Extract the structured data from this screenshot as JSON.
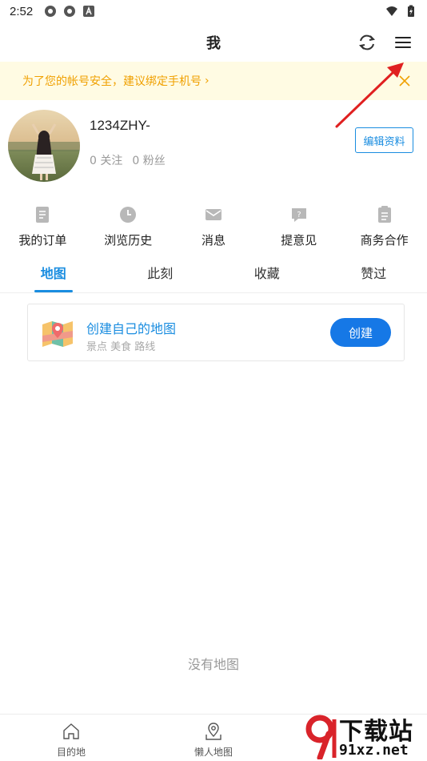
{
  "status_bar": {
    "time": "2:52"
  },
  "header": {
    "title": "我"
  },
  "banner": {
    "text": "为了您的帐号安全，建议绑定手机号",
    "chevron": "›"
  },
  "profile": {
    "username": "1234ZHY-",
    "following": "0 关注",
    "fans": "0 粉丝",
    "edit_label": "编辑资料"
  },
  "quick_entries": [
    {
      "label": "我的订单",
      "icon": "order-icon"
    },
    {
      "label": "浏览历史",
      "icon": "clock-icon"
    },
    {
      "label": "消息",
      "icon": "mail-icon"
    },
    {
      "label": "提意见",
      "icon": "feedback-icon"
    },
    {
      "label": "商务合作",
      "icon": "clipboard-icon"
    }
  ],
  "tabs": [
    {
      "label": "地图",
      "active": true
    },
    {
      "label": "此刻",
      "active": false
    },
    {
      "label": "收藏",
      "active": false
    },
    {
      "label": "赞过",
      "active": false
    }
  ],
  "create_card": {
    "title": "创建自己的地图",
    "subtitle": "景点 美食 路线",
    "button": "创建"
  },
  "empty_state": "没有地图",
  "bottom_nav": [
    {
      "label": "目的地",
      "icon": "home-icon"
    },
    {
      "label": "懒人地图",
      "icon": "map-pin-icon"
    }
  ],
  "watermark": {
    "top": "下载站",
    "bottom": "91xz.net"
  },
  "colors": {
    "accent": "#1a8de0",
    "banner_bg": "#fffbe3",
    "banner_text": "#f0a000",
    "arrow": "#e02020"
  }
}
